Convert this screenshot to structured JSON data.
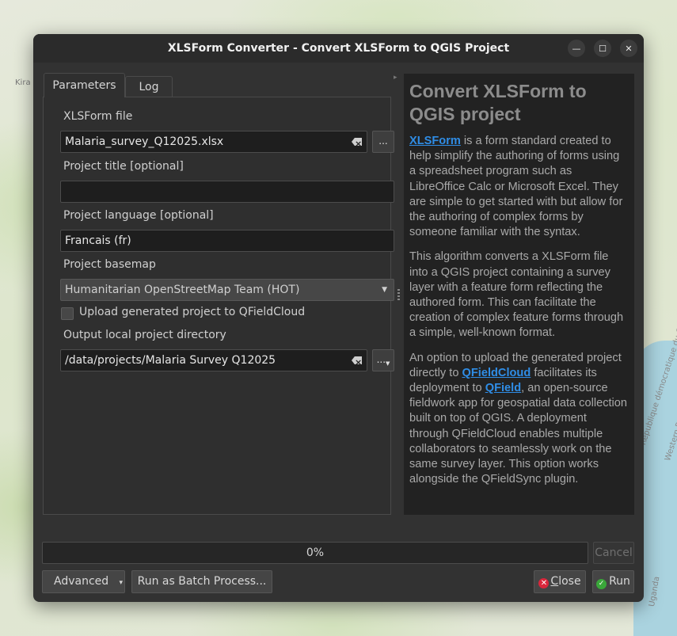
{
  "window": {
    "title": "XLSForm Converter - Convert XLSForm to QGIS Project",
    "minimize_glyph": "—",
    "maximize_glyph": "☐",
    "close_glyph": "✕"
  },
  "map": {
    "labels": {
      "kira": "Kira",
      "rd": "République démocratique du Congo",
      "wr": "Western Region",
      "ug": "Uganda"
    }
  },
  "tabs": [
    {
      "label": "Parameters",
      "active": true
    },
    {
      "label": "Log",
      "active": false
    }
  ],
  "form": {
    "xlsform_label": "XLSForm file",
    "xlsform_value": "Malaria_survey_Q12025.xlsx",
    "browse_label": "...",
    "title_label": "Project title [optional]",
    "title_value": "",
    "language_label": "Project language [optional]",
    "language_value": "Francais (fr)",
    "basemap_label": "Project basemap",
    "basemap_value": "Humanitarian OpenStreetMap Team (HOT)",
    "upload_label": "Upload generated project to QFieldCloud",
    "upload_checked": false,
    "output_label": "Output local project directory",
    "output_value": "/data/projects/Malaria Survey Q12025",
    "output_browse_label": "..."
  },
  "help": {
    "heading": "Convert XLSForm to QGIS project",
    "p1_link": "XLSForm",
    "p1_rest": " is a form standard created to help simplify the authoring of forms using a spreadsheet program such as LibreOffice Calc or Microsoft Excel. They are simple to get started with but allow for the authoring of complex forms by someone familiar with the syntax.",
    "p2": "This algorithm converts a XLSForm file into a QGIS project containing a survey layer with a feature form reflecting the authored form. This can facilitate the creation of complex feature forms through a simple, well-known format.",
    "p3_a": "An option to upload the generated project directly to ",
    "p3_link1": "QFieldCloud",
    "p3_b": " facilitates its deployment to ",
    "p3_link2": "QField",
    "p3_c": ", an open-source fieldwork app for geospatial data collection built on top of QGIS. A deployment through QFieldCloud enables multiple collaborators to seamlessly work on the same survey layer. This option works alongside the QFieldSync plugin."
  },
  "progress": {
    "label": "0%",
    "value": 0
  },
  "buttons": {
    "cancel": "Cancel",
    "advanced": "Advanced",
    "batch": "Run as Batch Process...",
    "close_first": "C",
    "close_rest": "lose",
    "run": "Run"
  },
  "colors": {
    "link": "#2f8de6",
    "dialog_bg": "#323232",
    "close_icon": "#d9263b",
    "run_icon": "#3aa73a"
  }
}
